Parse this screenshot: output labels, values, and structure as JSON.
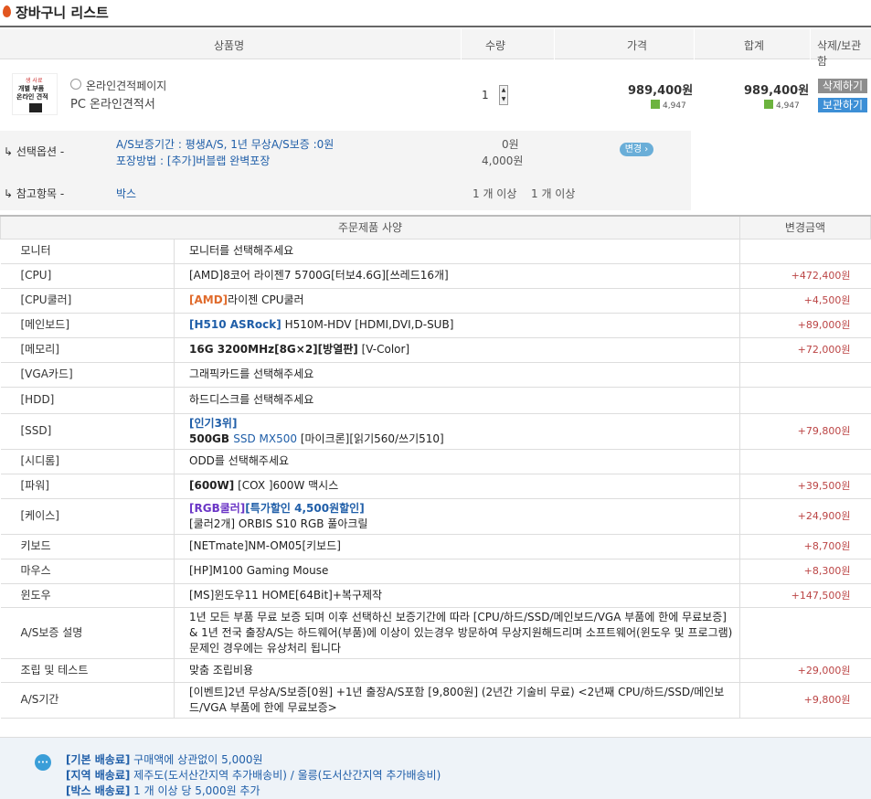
{
  "title": "장바구니 리스트",
  "cart_header": {
    "product": "상품명",
    "quantity": "수량",
    "price": "가격",
    "total": "합계",
    "action": "삭제/보관함"
  },
  "product": {
    "thumb_line1": "생 사료",
    "thumb_line2": "개별 부품",
    "thumb_line3": "온라인 견적",
    "seller": "온라인견적페이지",
    "name": "PC 온라인견적서",
    "quantity": "1",
    "price": "989,400원",
    "price_point": "4,947",
    "total": "989,400원",
    "total_point": "4,947",
    "delete_label": "삭제하기",
    "save_label": "보관하기"
  },
  "options": {
    "select_label": "↳ 선택옵션 -",
    "select_line1": "A/S보증기간 : 평생A/S, 1년 무상A/S보증 :0원",
    "select_line1_price": "0원",
    "select_line2": "포장방법 : [추가]버블랩 완벽포장",
    "select_line2_price": "4,000원",
    "change_label": "변경 ›",
    "ref_label": "↳ 참고항목 -",
    "ref_value": "박스",
    "ref_qty1": "1 개 이상",
    "ref_qty2": "1 개 이상"
  },
  "spec_header": {
    "spec": "주문제품 사양",
    "amount": "변경금액"
  },
  "spec_rows": [
    {
      "cat": "모니터",
      "parts": [
        {
          "t": "모니터를 선택해주세요",
          "s": ""
        }
      ],
      "amt": ""
    },
    {
      "cat": "[CPU]",
      "parts": [
        {
          "t": "[AMD]8코어 라이젠7 5700G[터보4.6G][쓰레드16개]",
          "s": ""
        }
      ],
      "amt": "+472,400원"
    },
    {
      "cat": "[CPU쿨러]",
      "parts": [
        {
          "t": "[AMD]",
          "s": "orange"
        },
        {
          "t": "라이젠 CPU쿨러",
          "s": ""
        }
      ],
      "amt": "+4,500원"
    },
    {
      "cat": "[메인보드]",
      "parts": [
        {
          "t": "[H510 ASRock]",
          "s": "blue"
        },
        {
          "t": " H510M-HDV [HDMI,DVI,D-SUB]",
          "s": ""
        }
      ],
      "amt": "+89,000원"
    },
    {
      "cat": "[메모리]",
      "parts": [
        {
          "t": "16G 3200MHz[8G×2][방열판]",
          "s": "b"
        },
        {
          "t": " [V-Color]",
          "s": ""
        }
      ],
      "amt": "+72,000원"
    },
    {
      "cat": "[VGA카드]",
      "parts": [
        {
          "t": "그래픽카드를 선택해주세요",
          "s": ""
        }
      ],
      "amt": ""
    },
    {
      "cat": "[HDD]",
      "parts": [
        {
          "t": "하드디스크를 선택해주세요",
          "s": ""
        }
      ],
      "amt": ""
    },
    {
      "cat": "[SSD]",
      "parts": [
        {
          "t": "[인기3위]",
          "s": "blue"
        },
        {
          "t": "\n",
          "s": "br"
        },
        {
          "t": "500GB ",
          "s": "b"
        },
        {
          "t": "SSD MX500",
          "s": "blue-n"
        },
        {
          "t": " [마이크론][읽기560/쓰기510]",
          "s": ""
        }
      ],
      "amt": "+79,800원"
    },
    {
      "cat": "[시디롬]",
      "parts": [
        {
          "t": "ODD를 선택해주세요",
          "s": ""
        }
      ],
      "amt": ""
    },
    {
      "cat": "[파워]",
      "parts": [
        {
          "t": "[600W]",
          "s": "b"
        },
        {
          "t": " [COX ]600W 맥시스",
          "s": ""
        }
      ],
      "amt": "+39,500원"
    },
    {
      "cat": "[케이스]",
      "parts": [
        {
          "t": "[RGB쿨러]",
          "s": "purple"
        },
        {
          "t": "[특가할인 4,500원할인]",
          "s": "blue"
        },
        {
          "t": "\n",
          "s": "br"
        },
        {
          "t": "[쿨러2개] ORBIS S10 RGB 풀아크릴",
          "s": ""
        }
      ],
      "amt": "+24,900원"
    },
    {
      "cat": "키보드",
      "parts": [
        {
          "t": "[NETmate]NM-OM05[키보드]",
          "s": ""
        }
      ],
      "amt": "+8,700원"
    },
    {
      "cat": "마우스",
      "parts": [
        {
          "t": "[HP]M100 Gaming Mouse",
          "s": ""
        }
      ],
      "amt": "+8,300원"
    },
    {
      "cat": "윈도우",
      "parts": [
        {
          "t": "[MS]윈도우11 HOME[64Bit]+복구제작",
          "s": ""
        }
      ],
      "amt": "+147,500원"
    },
    {
      "cat": "A/S보증 설명",
      "parts": [
        {
          "t": "1년 모든 부품 무료 보증 되며 이후 선택하신 보증기간에 따라 [CPU/하드/SSD/메인보드/VGA 부품에 한에 무료보증] & 1년 전국 출장A/S는 하드웨어(부품)에 이상이 있는경우 방문하여 무상지원해드리며 소프트웨어(윈도우 및 프로그램)문제인 경우에는 유상처리 됩니다",
          "s": ""
        }
      ],
      "amt": ""
    },
    {
      "cat": "조립 및 테스트",
      "parts": [
        {
          "t": "맞춤 조립비용",
          "s": ""
        }
      ],
      "amt": "+29,000원"
    },
    {
      "cat": "A/S기간",
      "parts": [
        {
          "t": "[이벤트]2년 무상A/S보증[0원] +1년 출장A/S포함 [9,800원] (2년간 기술비 무료) <2년째 CPU/하드/SSD/메인보드/VGA 부품에 한에 무료보증>",
          "s": ""
        }
      ],
      "amt": "+9,800원"
    }
  ],
  "shipping": {
    "icon": "chat-bubble-icon",
    "line1_label": "[기본 배송료]",
    "line1_text": " 구매액에 상관없이 5,000원",
    "line2_label": "[지역 배송료]",
    "line2_text": " 제주도(도서산간지역 추가배송비) / 울릉(도서산간지역 추가배송비)",
    "line3_label": "[박스 배송료]",
    "line3_text": " 1 개 이상 당 5,000원 추가"
  }
}
